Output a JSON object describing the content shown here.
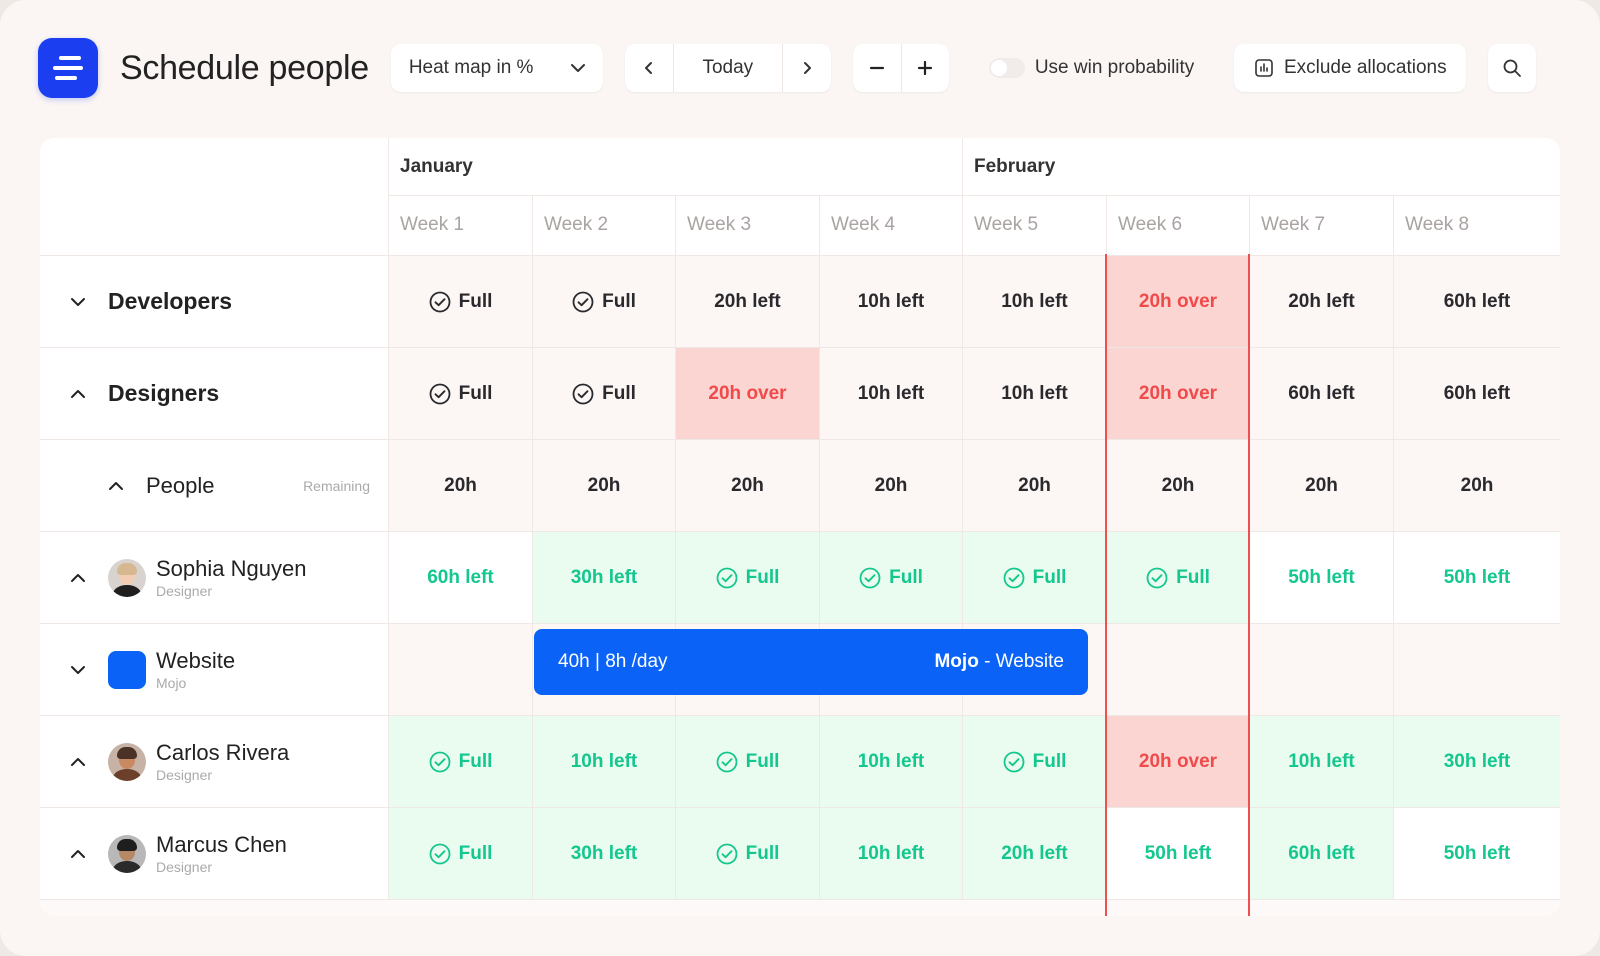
{
  "header": {
    "title": "Schedule people",
    "view_select": "Heat map in %",
    "today": "Today",
    "win_probability": "Use win probability",
    "exclude": "Exclude allocations"
  },
  "months": [
    "January",
    "February"
  ],
  "weeks": [
    "Week 1",
    "Week 2",
    "Week 3",
    "Week 4",
    "Week 5",
    "Week 6",
    "Week 7",
    "Week 8"
  ],
  "groups": [
    {
      "label": "Developers",
      "expanded": false,
      "cells": [
        [
          "Full",
          "full"
        ],
        [
          "Full",
          "full"
        ],
        [
          "20h left",
          "left"
        ],
        [
          "10h left",
          "left"
        ],
        [
          "10h left",
          "left"
        ],
        [
          "20h over",
          "over"
        ],
        [
          "20h left",
          "left"
        ],
        [
          "60h left",
          "left"
        ]
      ]
    },
    {
      "label": "Designers",
      "expanded": true,
      "cells": [
        [
          "Full",
          "full"
        ],
        [
          "Full",
          "full"
        ],
        [
          "20h over",
          "over"
        ],
        [
          "10h left",
          "left"
        ],
        [
          "10h left",
          "left"
        ],
        [
          "20h over",
          "over"
        ],
        [
          "60h left",
          "left"
        ],
        [
          "60h left",
          "left"
        ]
      ]
    }
  ],
  "people_row": {
    "label": "People",
    "remaining": "Remaining",
    "cells": [
      "20h",
      "20h",
      "20h",
      "20h",
      "20h",
      "20h",
      "20h",
      "20h"
    ]
  },
  "people": [
    {
      "name": "Sophia Nguyen",
      "role": "Designer",
      "cells": [
        [
          "60h left",
          "white"
        ],
        [
          "30h left",
          "green"
        ],
        [
          "Full",
          "green"
        ],
        [
          "Full",
          "green"
        ],
        [
          "Full",
          "green"
        ],
        [
          "Full",
          "green"
        ],
        [
          "50h left",
          "white"
        ],
        [
          "50h left",
          "white"
        ]
      ]
    },
    {
      "name": "Carlos Rivera",
      "role": "Designer",
      "cells": [
        [
          "Full",
          "green"
        ],
        [
          "10h left",
          "green"
        ],
        [
          "Full",
          "green"
        ],
        [
          "10h left",
          "green"
        ],
        [
          "Full",
          "green"
        ],
        [
          "20h over",
          "over"
        ],
        [
          "10h left",
          "green"
        ],
        [
          "30h left",
          "green"
        ]
      ]
    },
    {
      "name": "Marcus Chen",
      "role": "Designer",
      "cells": [
        [
          "Full",
          "green"
        ],
        [
          "30h left",
          "green"
        ],
        [
          "Full",
          "green"
        ],
        [
          "10h left",
          "green"
        ],
        [
          "20h left",
          "green"
        ],
        [
          "50h left",
          "white"
        ],
        [
          "60h left",
          "green"
        ],
        [
          "50h left",
          "white"
        ]
      ]
    }
  ],
  "project": {
    "name": "Website",
    "client": "Mojo",
    "booking_hours": "40h | 8h /day",
    "booking_client": "Mojo",
    "booking_sep": " - ",
    "booking_project": "Website"
  },
  "colors": {
    "brand": "#1b3ff0",
    "booking": "#0a63f6",
    "green_text": "#14c78f",
    "over_bg": "#fbd5d2",
    "over_text": "#f04a4a",
    "today_line": "#ef4f4f"
  },
  "icons": {
    "logo": "logo-icon",
    "select": "chevron-down-icon",
    "prev": "chevron-left-icon",
    "next": "chevron-right-icon",
    "zoom_out": "minus-icon",
    "zoom_in": "plus-icon",
    "exclude": "bar-chart-icon",
    "search": "search-icon",
    "full": "check-circle-icon"
  }
}
